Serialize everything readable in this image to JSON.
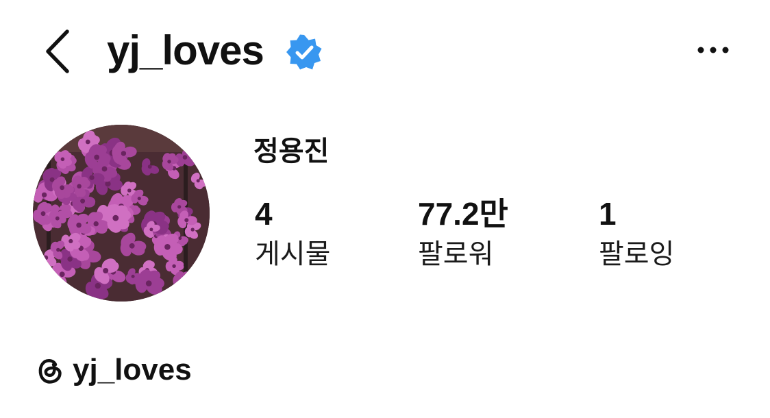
{
  "header": {
    "username": "yj_loves",
    "verified": true,
    "back_icon": "chevron-left-icon",
    "more_icon": "more-horizontal-icon",
    "verified_color": "#3897f0"
  },
  "profile": {
    "display_name": "정용진",
    "avatar_description": "purple orchids"
  },
  "stats": [
    {
      "value": "4",
      "label": "게시물"
    },
    {
      "value": "77.2만",
      "label": "팔로워"
    },
    {
      "value": "1",
      "label": "팔로잉"
    }
  ],
  "threads": {
    "icon": "threads-icon",
    "handle": "yj_loves"
  }
}
